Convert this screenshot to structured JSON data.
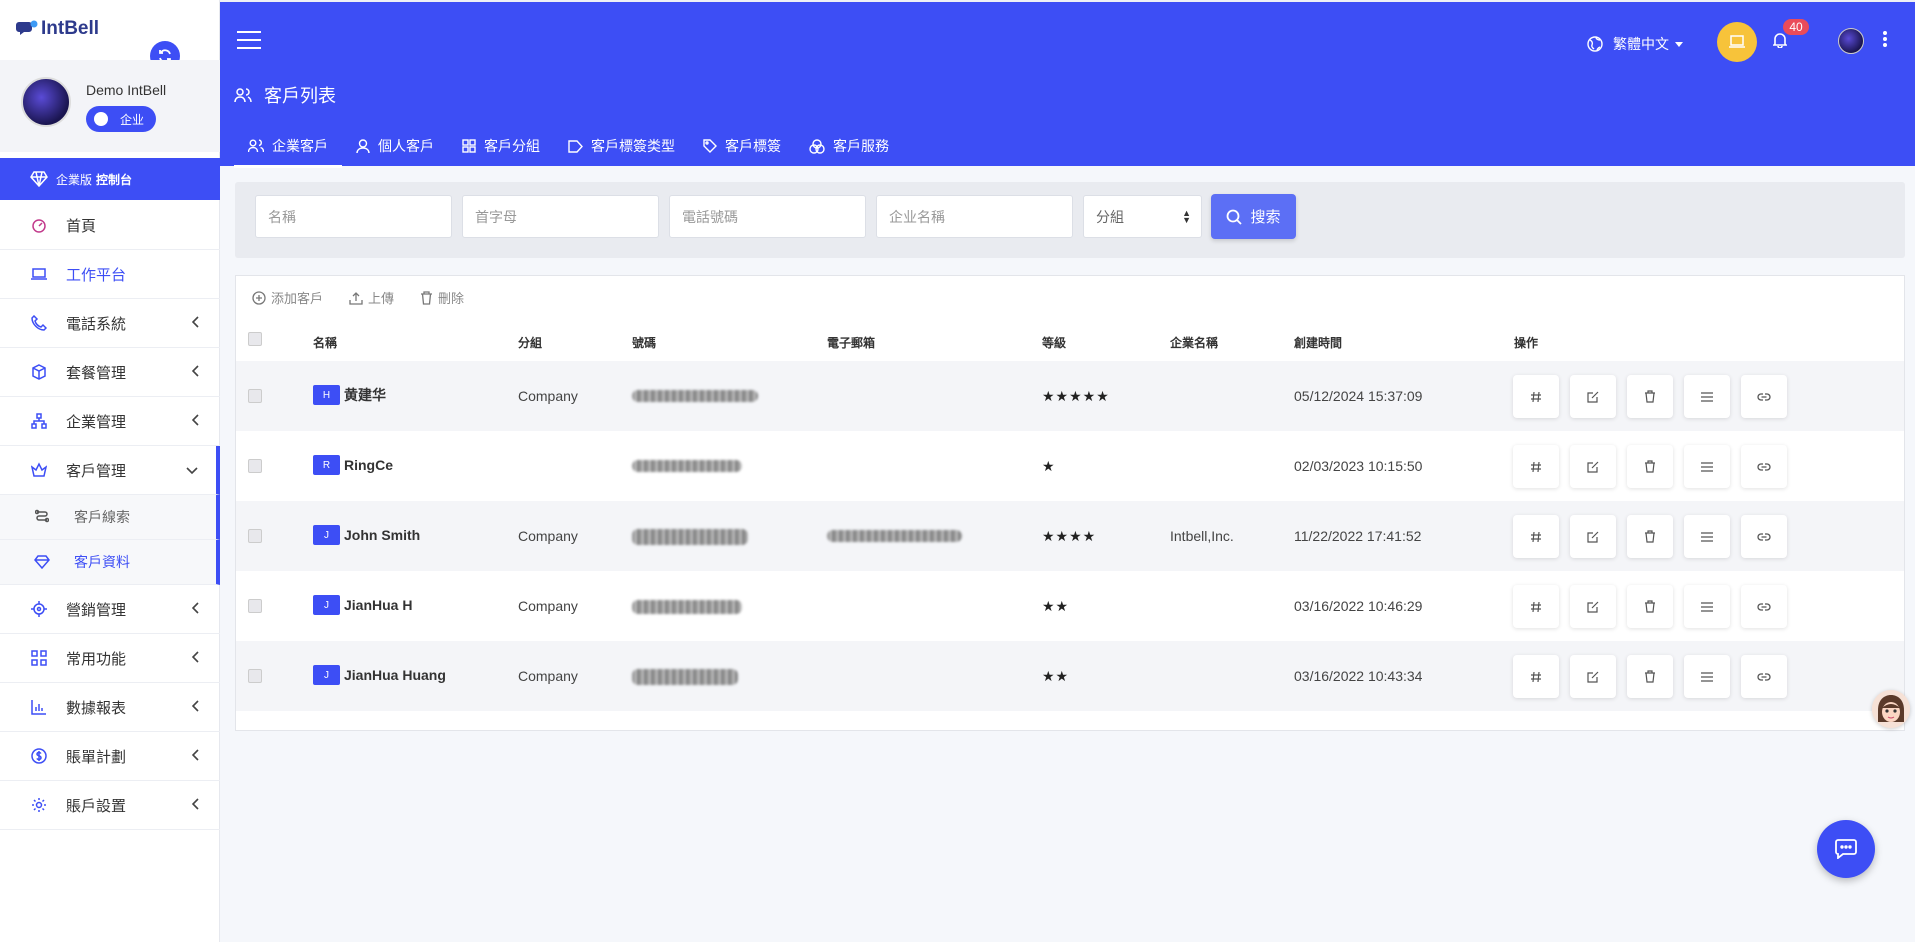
{
  "app": {
    "logo_text": "IntBell"
  },
  "profile": {
    "name": "Demo IntBell",
    "toggle_label": "企业"
  },
  "enterprise_bar": {
    "prefix": "企業版",
    "label": "控制台"
  },
  "menu": [
    {
      "label": "首頁",
      "icon": "dashboard-icon"
    },
    {
      "label": "工作平台",
      "icon": "laptop-icon"
    },
    {
      "label": "電話系統",
      "icon": "phone-icon"
    },
    {
      "label": "套餐管理",
      "icon": "box-icon"
    },
    {
      "label": "企業管理",
      "icon": "org-chart-icon"
    },
    {
      "label": "客戶管理",
      "icon": "crown-icon"
    },
    {
      "label": "營銷管理",
      "icon": "target-icon"
    },
    {
      "label": "常用功能",
      "icon": "grid-icon"
    },
    {
      "label": "數據報表",
      "icon": "bar-chart-icon"
    },
    {
      "label": "賬單計劃",
      "icon": "dollar-icon"
    },
    {
      "label": "賬戶設置",
      "icon": "gear-icon"
    }
  ],
  "submenu": [
    {
      "label": "客戶線索",
      "icon": "route-icon"
    },
    {
      "label": "客戶資料",
      "icon": "diamond-icon"
    }
  ],
  "header": {
    "language": "繁體中文",
    "notification_count": "40",
    "page_title": "客戶列表"
  },
  "tabs": [
    {
      "label": "企業客戶",
      "icon": "users-icon"
    },
    {
      "label": "個人客戶",
      "icon": "user-icon"
    },
    {
      "label": "客戶分組",
      "icon": "grid-icon"
    },
    {
      "label": "客戶標簽类型",
      "icon": "tag-outline-icon"
    },
    {
      "label": "客戶標簽",
      "icon": "tag-icon"
    },
    {
      "label": "客戶服務",
      "icon": "circles-icon"
    }
  ],
  "search": {
    "name_placeholder": "名稱",
    "initial_placeholder": "首字母",
    "phone_placeholder": "電話號碼",
    "company_placeholder": "企业名稱",
    "group_select": "分組",
    "button": "搜索"
  },
  "toolbar": {
    "add": "添加客戶",
    "upload": "上傳",
    "delete": "刪除"
  },
  "table": {
    "headers": [
      "名稱",
      "分組",
      "號碼",
      "電子郵箱",
      "等級",
      "企業名稱",
      "創建時間",
      "操作"
    ],
    "rows": [
      {
        "initial": "H",
        "name": "黄建华",
        "group": "Company",
        "stars": "★★★★★",
        "company": "",
        "created": "05/12/2024 15:37:09"
      },
      {
        "initial": "R",
        "name": "RingCe",
        "group": "",
        "stars": "★",
        "company": "",
        "created": "02/03/2023 10:15:50"
      },
      {
        "initial": "J",
        "name": "John Smith",
        "group": "Company",
        "stars": "★★★★",
        "company": "Intbell,Inc.",
        "created": "11/22/2022 17:41:52"
      },
      {
        "initial": "J",
        "name": "JianHua H",
        "group": "Company",
        "stars": "★★",
        "company": "",
        "created": "03/16/2022 10:46:29"
      },
      {
        "initial": "J",
        "name": "JianHua Huang",
        "group": "Company",
        "stars": "★★",
        "company": "",
        "created": "03/16/2022 10:43:34"
      }
    ]
  },
  "colors": {
    "primary": "#3d4ef5",
    "badge": "#ea4b5a",
    "accent_yellow": "#f7c33a"
  }
}
